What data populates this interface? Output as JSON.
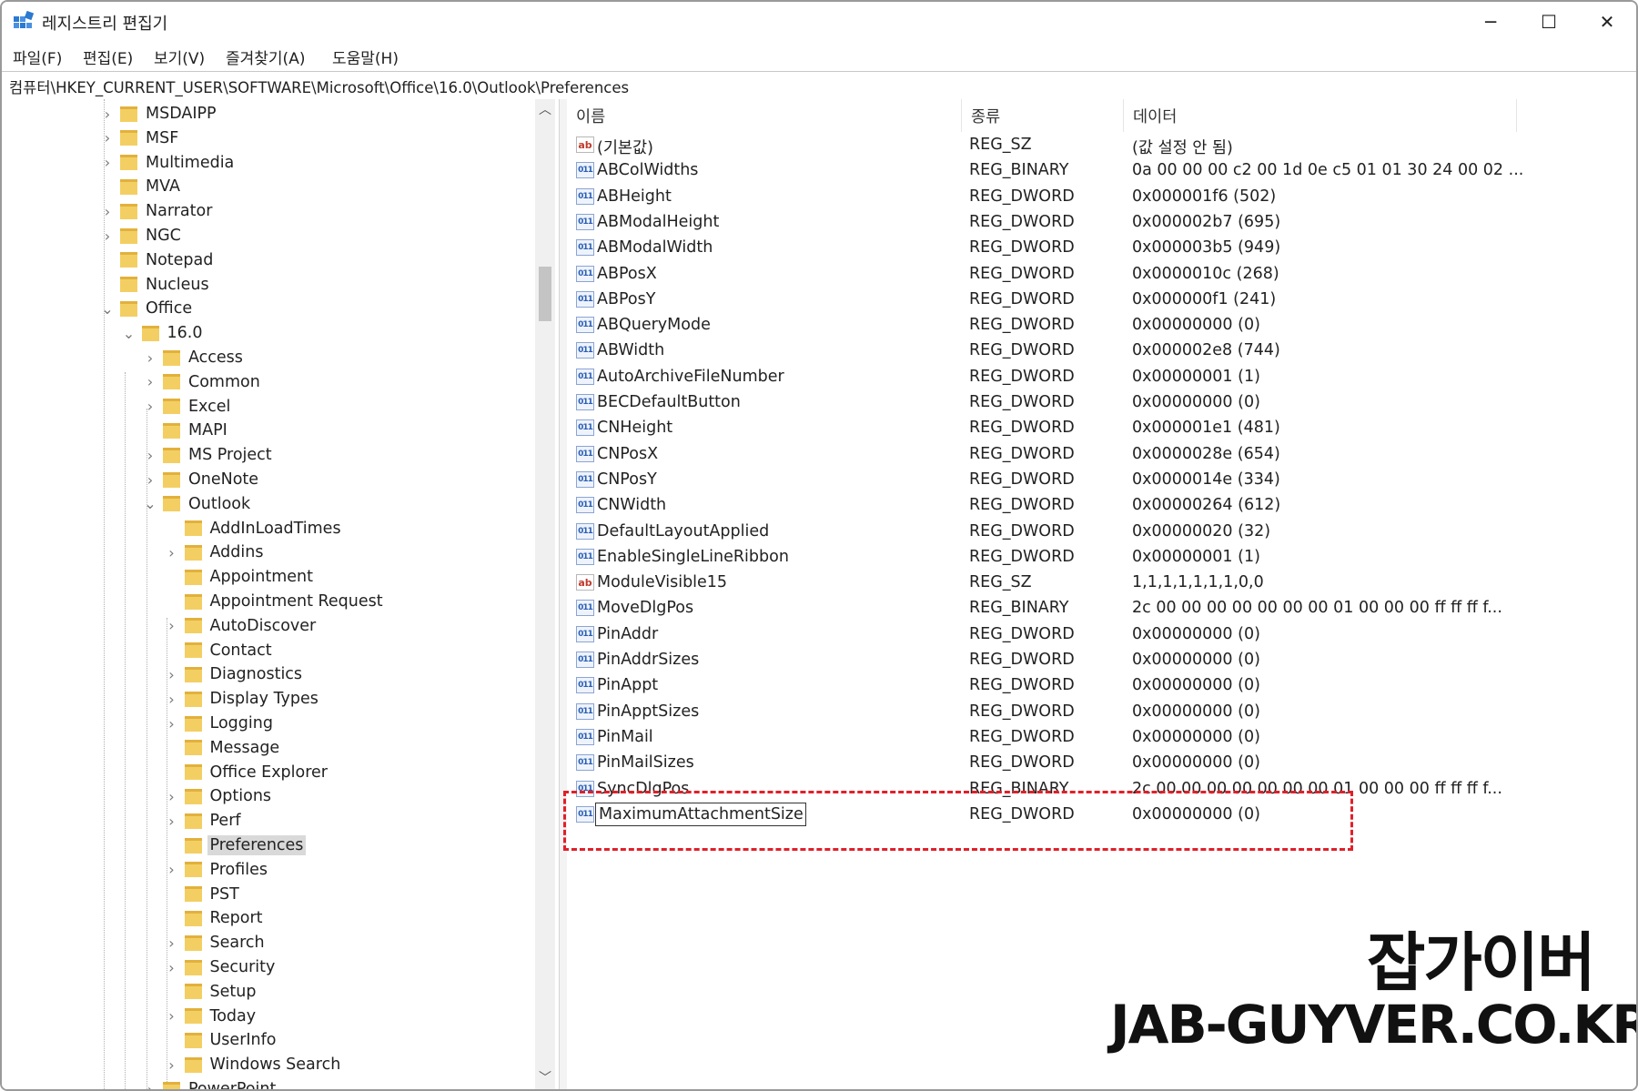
{
  "window": {
    "title": "레지스트리 편집기",
    "minimize_glyph": "─",
    "maximize_glyph": "☐",
    "close_glyph": "✕"
  },
  "menu": [
    "파일(F)",
    "편집(E)",
    "보기(V)",
    "즐겨찾기(A)",
    "도움말(H)"
  ],
  "address": "컴퓨터\\HKEY_CURRENT_USER\\SOFTWARE\\Microsoft\\Office\\16.0\\Outlook\\Preferences",
  "tree": {
    "items": [
      {
        "label": "MSDAIPP",
        "level": 0,
        "chevron": "›"
      },
      {
        "label": "MSF",
        "level": 0,
        "chevron": "›"
      },
      {
        "label": "Multimedia",
        "level": 0,
        "chevron": "›"
      },
      {
        "label": "MVA",
        "level": 0,
        "chevron": ""
      },
      {
        "label": "Narrator",
        "level": 0,
        "chevron": "›"
      },
      {
        "label": "NGC",
        "level": 0,
        "chevron": "›"
      },
      {
        "label": "Notepad",
        "level": 0,
        "chevron": ""
      },
      {
        "label": "Nucleus",
        "level": 0,
        "chevron": ""
      },
      {
        "label": "Office",
        "level": 0,
        "chevron": "⌄"
      },
      {
        "label": "16.0",
        "level": 1,
        "chevron": "⌄"
      },
      {
        "label": "Access",
        "level": 2,
        "chevron": "›"
      },
      {
        "label": "Common",
        "level": 2,
        "chevron": "›"
      },
      {
        "label": "Excel",
        "level": 2,
        "chevron": "›"
      },
      {
        "label": "MAPI",
        "level": 2,
        "chevron": ""
      },
      {
        "label": "MS Project",
        "level": 2,
        "chevron": "›"
      },
      {
        "label": "OneNote",
        "level": 2,
        "chevron": "›"
      },
      {
        "label": "Outlook",
        "level": 2,
        "chevron": "⌄"
      },
      {
        "label": "AddInLoadTimes",
        "level": 3,
        "chevron": ""
      },
      {
        "label": "Addins",
        "level": 3,
        "chevron": "›"
      },
      {
        "label": "Appointment",
        "level": 3,
        "chevron": ""
      },
      {
        "label": "Appointment Request",
        "level": 3,
        "chevron": ""
      },
      {
        "label": "AutoDiscover",
        "level": 3,
        "chevron": "›"
      },
      {
        "label": "Contact",
        "level": 3,
        "chevron": ""
      },
      {
        "label": "Diagnostics",
        "level": 3,
        "chevron": "›"
      },
      {
        "label": "Display Types",
        "level": 3,
        "chevron": "›"
      },
      {
        "label": "Logging",
        "level": 3,
        "chevron": "›"
      },
      {
        "label": "Message",
        "level": 3,
        "chevron": ""
      },
      {
        "label": "Office Explorer",
        "level": 3,
        "chevron": ""
      },
      {
        "label": "Options",
        "level": 3,
        "chevron": "›"
      },
      {
        "label": "Perf",
        "level": 3,
        "chevron": "›"
      },
      {
        "label": "Preferences",
        "level": 3,
        "chevron": "",
        "selected": true
      },
      {
        "label": "Profiles",
        "level": 3,
        "chevron": "›"
      },
      {
        "label": "PST",
        "level": 3,
        "chevron": ""
      },
      {
        "label": "Report",
        "level": 3,
        "chevron": ""
      },
      {
        "label": "Search",
        "level": 3,
        "chevron": "›"
      },
      {
        "label": "Security",
        "level": 3,
        "chevron": "›"
      },
      {
        "label": "Setup",
        "level": 3,
        "chevron": ""
      },
      {
        "label": "Today",
        "level": 3,
        "chevron": "›"
      },
      {
        "label": "UserInfo",
        "level": 3,
        "chevron": ""
      },
      {
        "label": "Windows Search",
        "level": 3,
        "chevron": "›"
      },
      {
        "label": "PowerPoint",
        "level": 2,
        "chevron": "›"
      }
    ]
  },
  "list": {
    "headers": {
      "name": "이름",
      "type": "종류",
      "data": "데이터"
    },
    "rows": [
      {
        "icon": "string-value-icon",
        "name": "(기본값)",
        "type": "REG_SZ",
        "data": "(값 설정 안 됨)"
      },
      {
        "icon": "binary-value-icon",
        "name": "ABColWidths",
        "type": "REG_BINARY",
        "data": "0a 00 00 00 c2 00 1d 0e c5 01 01 30 24 00 02 ..."
      },
      {
        "icon": "binary-value-icon",
        "name": "ABHeight",
        "type": "REG_DWORD",
        "data": "0x000001f6 (502)"
      },
      {
        "icon": "binary-value-icon",
        "name": "ABModalHeight",
        "type": "REG_DWORD",
        "data": "0x000002b7 (695)"
      },
      {
        "icon": "binary-value-icon",
        "name": "ABModalWidth",
        "type": "REG_DWORD",
        "data": "0x000003b5 (949)"
      },
      {
        "icon": "binary-value-icon",
        "name": "ABPosX",
        "type": "REG_DWORD",
        "data": "0x0000010c (268)"
      },
      {
        "icon": "binary-value-icon",
        "name": "ABPosY",
        "type": "REG_DWORD",
        "data": "0x000000f1 (241)"
      },
      {
        "icon": "binary-value-icon",
        "name": "ABQueryMode",
        "type": "REG_DWORD",
        "data": "0x00000000 (0)"
      },
      {
        "icon": "binary-value-icon",
        "name": "ABWidth",
        "type": "REG_DWORD",
        "data": "0x000002e8 (744)"
      },
      {
        "icon": "binary-value-icon",
        "name": "AutoArchiveFileNumber",
        "type": "REG_DWORD",
        "data": "0x00000001 (1)"
      },
      {
        "icon": "binary-value-icon",
        "name": "BECDefaultButton",
        "type": "REG_DWORD",
        "data": "0x00000000 (0)"
      },
      {
        "icon": "binary-value-icon",
        "name": "CNHeight",
        "type": "REG_DWORD",
        "data": "0x000001e1 (481)"
      },
      {
        "icon": "binary-value-icon",
        "name": "CNPosX",
        "type": "REG_DWORD",
        "data": "0x0000028e (654)"
      },
      {
        "icon": "binary-value-icon",
        "name": "CNPosY",
        "type": "REG_DWORD",
        "data": "0x0000014e (334)"
      },
      {
        "icon": "binary-value-icon",
        "name": "CNWidth",
        "type": "REG_DWORD",
        "data": "0x00000264 (612)"
      },
      {
        "icon": "binary-value-icon",
        "name": "DefaultLayoutApplied",
        "type": "REG_DWORD",
        "data": "0x00000020 (32)"
      },
      {
        "icon": "binary-value-icon",
        "name": "EnableSingleLineRibbon",
        "type": "REG_DWORD",
        "data": "0x00000001 (1)"
      },
      {
        "icon": "string-value-icon",
        "name": "ModuleVisible15",
        "type": "REG_SZ",
        "data": "1,1,1,1,1,1,1,0,0"
      },
      {
        "icon": "binary-value-icon",
        "name": "MoveDlgPos",
        "type": "REG_BINARY",
        "data": "2c 00 00 00 00 00 00 00 01 00 00 00 ff ff ff f..."
      },
      {
        "icon": "binary-value-icon",
        "name": "PinAddr",
        "type": "REG_DWORD",
        "data": "0x00000000 (0)"
      },
      {
        "icon": "binary-value-icon",
        "name": "PinAddrSizes",
        "type": "REG_DWORD",
        "data": "0x00000000 (0)"
      },
      {
        "icon": "binary-value-icon",
        "name": "PinAppt",
        "type": "REG_DWORD",
        "data": "0x00000000 (0)"
      },
      {
        "icon": "binary-value-icon",
        "name": "PinApptSizes",
        "type": "REG_DWORD",
        "data": "0x00000000 (0)"
      },
      {
        "icon": "binary-value-icon",
        "name": "PinMail",
        "type": "REG_DWORD",
        "data": "0x00000000 (0)"
      },
      {
        "icon": "binary-value-icon",
        "name": "PinMailSizes",
        "type": "REG_DWORD",
        "data": "0x00000000 (0)"
      },
      {
        "icon": "binary-value-icon",
        "name": "SyncDlgPos",
        "type": "REG_BINARY",
        "data": "2c 00 00 00 00 00 00 00 01 00 00 00 ff ff ff f..."
      },
      {
        "icon": "binary-value-icon",
        "name": "MaximumAttachmentSize",
        "type": "REG_DWORD",
        "data": "0x00000000 (0)",
        "editing": true
      }
    ]
  },
  "watermark": {
    "title": "잡가이버",
    "url": "JAB-GUYVER.CO.KR"
  },
  "colors": {
    "highlight": "#e0202a",
    "folder": "#f3cf63",
    "selection": "#d9d9d9"
  }
}
